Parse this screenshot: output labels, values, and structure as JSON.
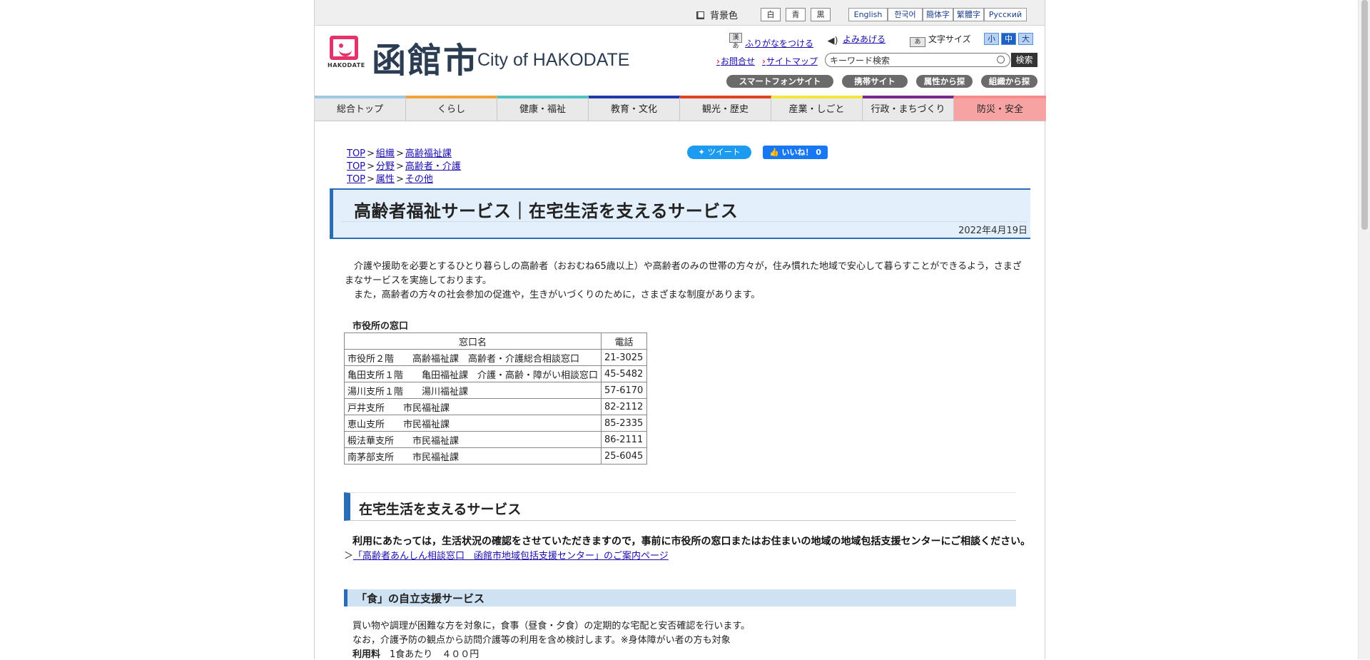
{
  "util_bar": {
    "bg_label": "背景色",
    "bg_options": [
      "白",
      "青",
      "黒"
    ],
    "languages": [
      "English",
      "한국어",
      "簡体字",
      "繁體字",
      "Русский"
    ]
  },
  "header": {
    "logo_caption": "HAKODATE",
    "logo_kanji": "函館市",
    "logo_en": "City of HAKODATE",
    "furigana": "ふりがなをつける",
    "furigana_icon": "漢あ",
    "read_aloud": "よみあげる",
    "fontsize_label": "文字サイズ",
    "fontsize_icon": "あ",
    "fontsize_options": [
      "小",
      "中",
      "大"
    ],
    "inquiry": "お問合せ",
    "sitemap": "サイトマップ",
    "search_value": "キーワード検索",
    "search_button": "検索",
    "pills": [
      "スマートフォンサイト",
      "携帯サイト",
      "属性から探す",
      "組織から探す"
    ]
  },
  "nav": {
    "items": [
      "総合トップ",
      "くらし",
      "健康・福祉",
      "教育・文化",
      "観光・歴史",
      "産業・しごと",
      "行政・まちづくり",
      "防災・安全"
    ],
    "colors": [
      "#9ec8e0",
      "#f3a23a",
      "#52c2c0",
      "#1e3ba6",
      "#e2431f",
      "#f4e63a",
      "#7a2a8a",
      "#f78b8b"
    ]
  },
  "breadcrumbs": [
    {
      "top": "TOP",
      "a": "組織",
      "b": "高齢福祉課"
    },
    {
      "top": "TOP",
      "a": "分野",
      "b": "高齢者・介護"
    },
    {
      "top": "TOP",
      "a": "属性",
      "b": "その他"
    }
  ],
  "social": {
    "tweet": "ツイート",
    "like": "いいね！ 0"
  },
  "page": {
    "title": "高齢者福祉サービス｜在宅生活を支えるサービス",
    "date": "2022年4月19日",
    "intro1": "　介護や援助を必要とするひとり暮らしの高齢者（おおむね65歳以上）や高齢者のみの世帯の方々が，住み慣れた地域で安心して暮らすことができるよう，さまざまなサービスを実施しております。",
    "intro2": "　また，高齢者の方々の社会参加の促進や，生きがいづくりのために，さまざまな制度があります。"
  },
  "office_table": {
    "caption": "市役所の窓口",
    "headers": [
      "窓口名",
      "電話"
    ],
    "rows": [
      [
        "市役所２階　　高齢福祉課　高齢者・介護総合相談窓口",
        "21-3025"
      ],
      [
        "亀田支所１階　　亀田福祉課　介護・高齢・障がい相談窓口",
        "45-5482"
      ],
      [
        "湯川支所１階　　湯川福祉課",
        "57-6170"
      ],
      [
        "戸井支所　　市民福祉課",
        "82-2112"
      ],
      [
        "恵山支所　　市民福祉課",
        "85-2335"
      ],
      [
        "椴法華支所　　市民福祉課",
        "86-2111"
      ],
      [
        "南茅部支所　　市民福祉課",
        "25-6045"
      ]
    ]
  },
  "section1": {
    "heading": "在宅生活を支えるサービス",
    "notice": "利用にあたっては，生活状況の確認をさせていただきますので，事前に市役所の窓口またはお住まいの地域の地域包括支援センターにご相談ください。",
    "link_prefix": "＞",
    "link": "「高齢者あんしん相談窓口　函館市地域包括支援センター」のご案内ページ"
  },
  "section2": {
    "heading": "「食」の自立支援サービス",
    "line1": "買い物や調理が困難な方を対象に，食事（昼食・夕食）の定期的な宅配と安否確認を行います。",
    "line2": "なお，介護予防の観点から訪問介護等の利用を含め検討します。※身体障がい者の方も対象",
    "fee_label": "利用料",
    "fee_value": "　1食あたり　４００円"
  }
}
